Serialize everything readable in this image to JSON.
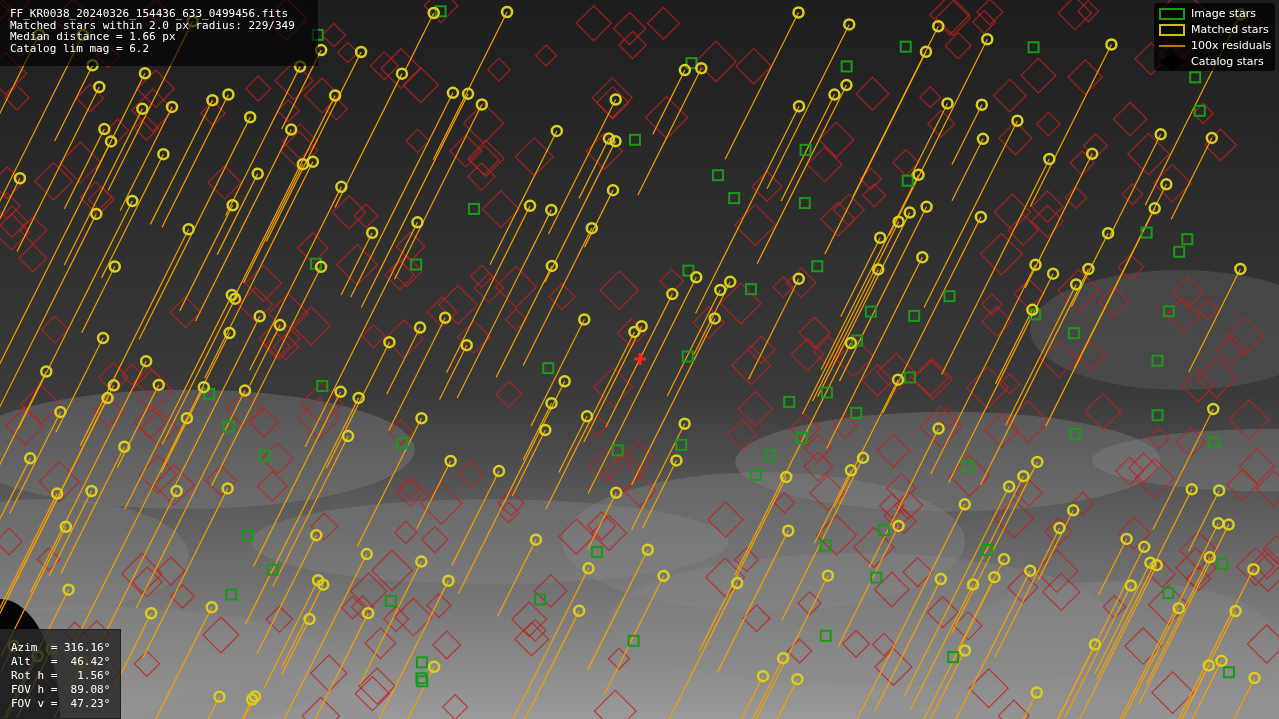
{
  "info": {
    "lines": [
      "FF_KR0038_20240326_154436_633_0499456.fits",
      "Matched stars within 2.0 px radius: 229/349",
      "Median distance = 1.66 px",
      "Catalog lim mag = 6.2"
    ]
  },
  "legend": [
    {
      "label": "Image stars"
    },
    {
      "kind": "matched",
      "label": "Matched stars"
    },
    {
      "kind": "residual",
      "label": "100x residuals"
    },
    {
      "kind": "catalog",
      "label": "Catalog stars"
    }
  ],
  "pointing": {
    "lines": [
      "Azim  = 316.16°",
      "Alt   =  46.42°",
      "Rot h =   1.56°",
      "FOV h =  89.08°",
      "FOV v =  47.23°"
    ]
  }
}
